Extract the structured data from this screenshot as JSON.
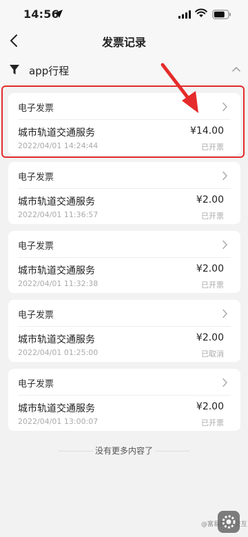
{
  "status_bar": {
    "time": "14:56"
  },
  "nav": {
    "title": "发票记录"
  },
  "filter": {
    "label": "app行程"
  },
  "invoices": [
    {
      "type": "电子发票",
      "service": "城市轨道交通服务",
      "amount": "¥14.00",
      "time": "2022/04/01 14:24:44",
      "status": "已开票"
    },
    {
      "type": "电子发票",
      "service": "城市轨道交通服务",
      "amount": "¥2.00",
      "time": "2022/04/01 11:36:57",
      "status": "已开票"
    },
    {
      "type": "电子发票",
      "service": "城市轨道交通服务",
      "amount": "¥2.00",
      "time": "2022/04/01 11:32:38",
      "status": "已开票"
    },
    {
      "type": "电子发票",
      "service": "城市轨道交通服务",
      "amount": "¥2.00",
      "time": "2022/04/01 01:25:00",
      "status": "已取消"
    },
    {
      "type": "电子发票",
      "service": "城市轨道交通服务",
      "amount": "¥2.00",
      "time": "2022/04/01 13:00:07",
      "status": "已开票"
    }
  ],
  "footer": {
    "no_more": "没有更多内容了"
  },
  "watermark": "@富易的2D交互",
  "colors": {
    "highlight": "#e52b2b",
    "background": "#f2f2f2",
    "card": "#ffffff"
  },
  "icons": [
    "location-arrow-icon",
    "signal-icon",
    "wifi-icon",
    "battery-icon",
    "back-icon",
    "filter-icon",
    "chevron-up-icon",
    "chevron-right-icon",
    "settings-widget-icon"
  ]
}
